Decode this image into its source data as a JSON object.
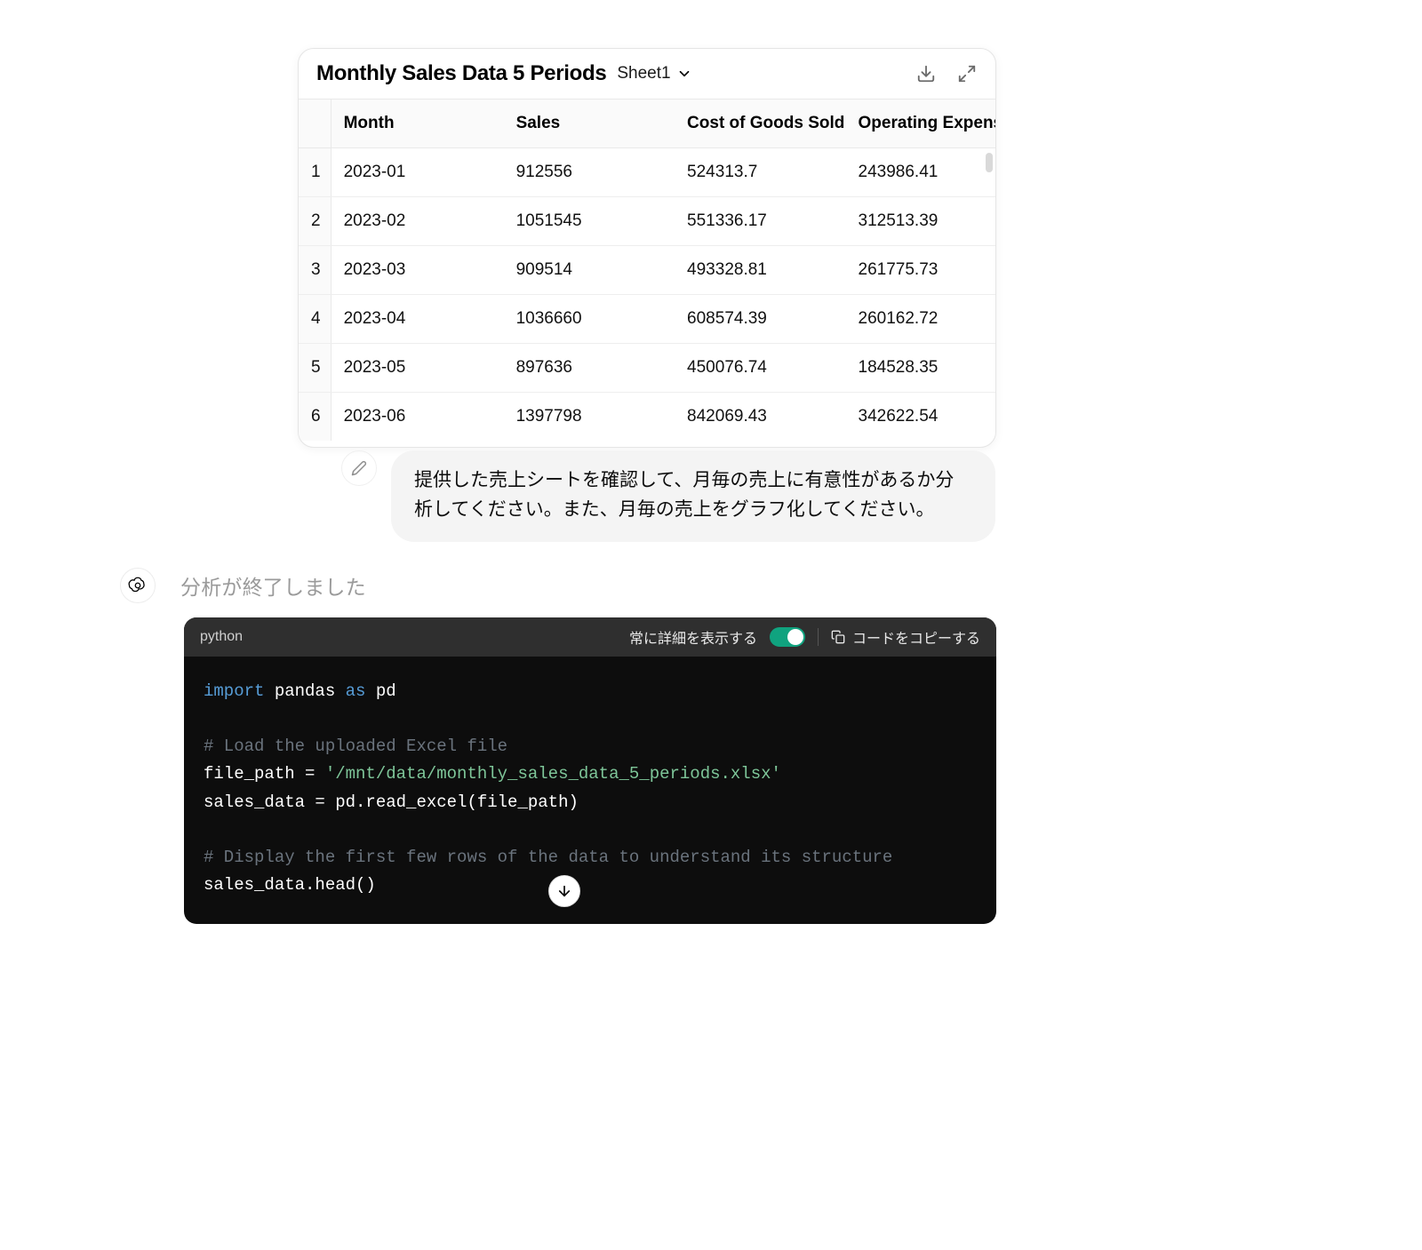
{
  "card": {
    "title": "Monthly Sales Data 5 Periods",
    "sheet_label": "Sheet1",
    "columns": [
      "Month",
      "Sales",
      "Cost of Goods Sold",
      "Operating Expense"
    ],
    "rows": [
      {
        "idx": "1",
        "month": "2023-01",
        "sales": "912556",
        "cogs": "524313.7",
        "opex": "243986.41"
      },
      {
        "idx": "2",
        "month": "2023-02",
        "sales": "1051545",
        "cogs": "551336.17",
        "opex": "312513.39"
      },
      {
        "idx": "3",
        "month": "2023-03",
        "sales": "909514",
        "cogs": "493328.81",
        "opex": "261775.73"
      },
      {
        "idx": "4",
        "month": "2023-04",
        "sales": "1036660",
        "cogs": "608574.39",
        "opex": "260162.72"
      },
      {
        "idx": "5",
        "month": "2023-05",
        "sales": "897636",
        "cogs": "450076.74",
        "opex": "184528.35"
      },
      {
        "idx": "6",
        "month": "2023-06",
        "sales": "1397798",
        "cogs": "842069.43",
        "opex": "342622.54"
      }
    ]
  },
  "user_message": "提供した売上シートを確認して、月毎の売上に有意性があるか分析してください。また、月毎の売上をグラフ化してください。",
  "assistant": {
    "status": "分析が終了しました"
  },
  "code": {
    "language": "python",
    "toggle_label": "常に詳細を表示する",
    "toggle_on": true,
    "copy_label": "コードをコピーする",
    "lines": [
      {
        "t": "code",
        "segs": [
          [
            "kw",
            "import"
          ],
          [
            "p",
            " pandas "
          ],
          [
            "kw",
            "as"
          ],
          [
            "p",
            " pd"
          ]
        ]
      },
      {
        "t": "blank"
      },
      {
        "t": "comment",
        "text": "# Load the uploaded Excel file"
      },
      {
        "t": "code",
        "segs": [
          [
            "p",
            "file_path = "
          ],
          [
            "str",
            "'/mnt/data/monthly_sales_data_5_periods.xlsx'"
          ]
        ]
      },
      {
        "t": "code",
        "segs": [
          [
            "p",
            "sales_data = pd.read_excel(file_path)"
          ]
        ]
      },
      {
        "t": "blank"
      },
      {
        "t": "comment",
        "text": "# Display the first few rows of the data to understand its structure"
      },
      {
        "t": "code",
        "segs": [
          [
            "p",
            "sales_data.head()"
          ]
        ]
      }
    ]
  }
}
